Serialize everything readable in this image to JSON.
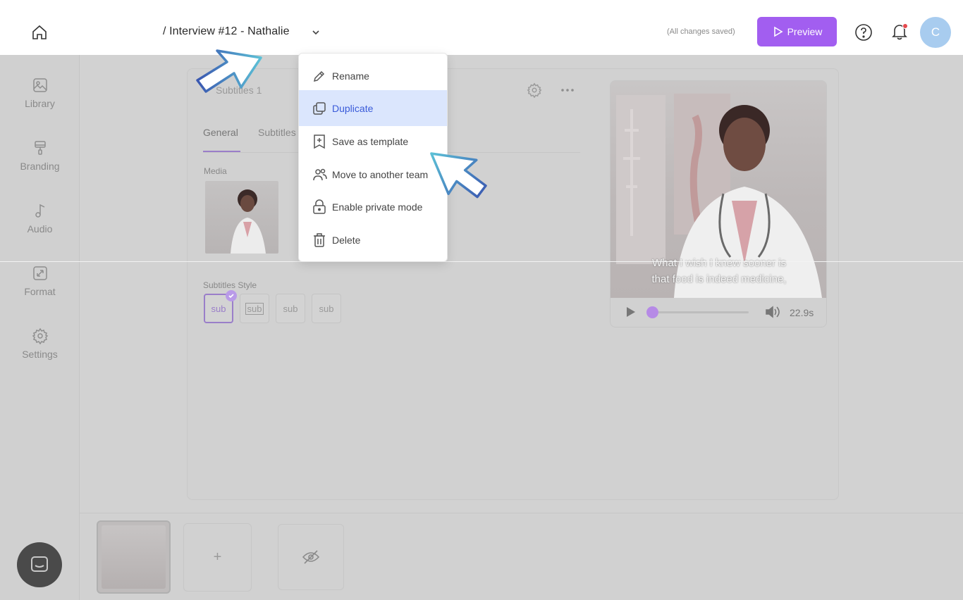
{
  "header": {
    "title": "/ Interview #12 - Nathalie",
    "save_status": "(All changes saved)",
    "preview_label": "Preview",
    "avatar_initial": "C",
    "notification_dot_color": "#e5484d",
    "accent_color": "#a25ef0"
  },
  "sidebar": {
    "items": [
      {
        "label": "Library",
        "icon": "image-icon"
      },
      {
        "label": "Branding",
        "icon": "paint-roller-icon"
      },
      {
        "label": "Audio",
        "icon": "music-note-icon"
      },
      {
        "label": "Format",
        "icon": "resize-icon"
      },
      {
        "label": "Settings",
        "icon": "gear-icon"
      }
    ]
  },
  "editor": {
    "section_title": "Subtitles 1",
    "tabs": [
      {
        "label": "General",
        "active": true
      },
      {
        "label": "Subtitles",
        "active": false
      }
    ],
    "media_label": "Media",
    "subtitles_style_label": "Subtitles Style",
    "style_chips": [
      "sub",
      "sub",
      "sub",
      "sub"
    ]
  },
  "video": {
    "caption_line1": "What I wish I knew sooner is",
    "caption_line2": "that food is indeed medicine,",
    "duration": "22.9s",
    "progress": 0.0
  },
  "timeline": {
    "add_label": "+"
  },
  "menu": {
    "items": [
      {
        "label": "Rename",
        "icon": "pencil-icon",
        "highlighted": false
      },
      {
        "label": "Duplicate",
        "icon": "duplicate-icon",
        "highlighted": true
      },
      {
        "label": "Save as template",
        "icon": "bookmark-plus-icon",
        "highlighted": false
      },
      {
        "label": "Move to another team",
        "icon": "team-icon",
        "highlighted": false
      },
      {
        "label": "Enable private mode",
        "icon": "lock-icon",
        "highlighted": false
      },
      {
        "label": "Delete",
        "icon": "trash-icon",
        "highlighted": false
      }
    ]
  }
}
